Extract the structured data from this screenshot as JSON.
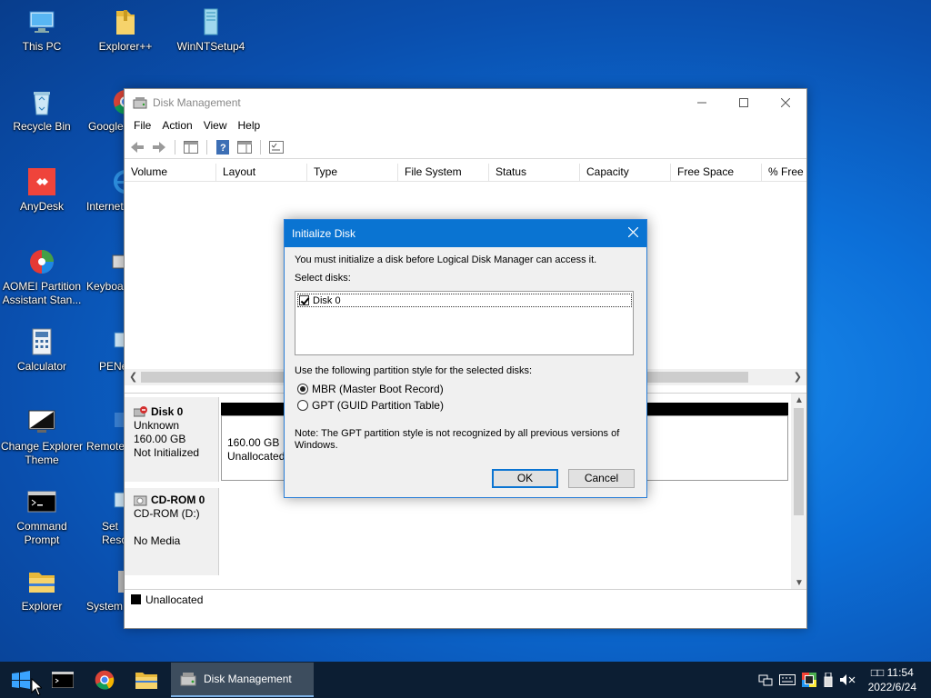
{
  "desktop": {
    "icons": [
      {
        "label": "This PC"
      },
      {
        "label": "Explorer++"
      },
      {
        "label": "WinNTSetup4"
      },
      {
        "label": "Recycle Bin"
      },
      {
        "label": "Google"
      },
      {
        "label": "AnyDesk"
      },
      {
        "label": "Internet"
      },
      {
        "label": "AOMEI Partition Assistant Stan..."
      },
      {
        "label": "Keyboa"
      },
      {
        "label": "Calculator"
      },
      {
        "label": "PENe"
      },
      {
        "label": "Change Explorer Theme"
      },
      {
        "label": "Remote"
      },
      {
        "label": "Command Prompt"
      },
      {
        "label": "Set Reso"
      },
      {
        "label": "Explorer"
      },
      {
        "label": "System"
      }
    ]
  },
  "window": {
    "title": "Disk Management",
    "menu": [
      "File",
      "Action",
      "View",
      "Help"
    ],
    "columns": [
      "Volume",
      "Layout",
      "Type",
      "File System",
      "Status",
      "Capacity",
      "Free Space",
      "% Free"
    ],
    "disks": [
      {
        "name": "Disk 0",
        "lines": [
          "Unknown",
          "160.00 GB",
          "Not Initialized"
        ],
        "partition_size": "160.00 GB",
        "partition_state": "Unallocated"
      },
      {
        "name": "CD-ROM 0",
        "lines": [
          "CD-ROM (D:)",
          "",
          "No Media"
        ]
      }
    ],
    "legend": "Unallocated"
  },
  "dialog": {
    "title": "Initialize Disk",
    "message": "You must initialize a disk before Logical Disk Manager can access it.",
    "select_label": "Select disks:",
    "disk_item": "Disk 0",
    "partition_label": "Use the following partition style for the selected disks:",
    "option_mbr": "MBR (Master Boot Record)",
    "option_gpt": "GPT (GUID Partition Table)",
    "note": "Note: The GPT partition style is not recognized by all previous versions of Windows.",
    "ok": "OK",
    "cancel": "Cancel"
  },
  "taskbar": {
    "active_app": "Disk Management",
    "time": "□□ 11:54",
    "date": "2022/6/24"
  },
  "colors": {
    "accent": "#0a74d2",
    "taskbar": "#0c1e33"
  }
}
